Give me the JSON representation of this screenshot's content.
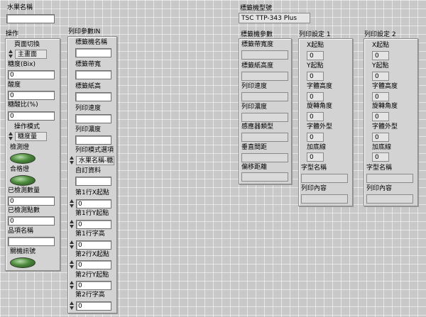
{
  "top": {
    "fruit_name_label": "水果名稱",
    "fruit_name_value": "",
    "printer_model_label": "標籤機型號",
    "printer_model_value": "TSC TTP-343 Plus"
  },
  "operation": {
    "title": "操作",
    "page_switch_label": "頁面切換",
    "page_switch_value": "主畫面",
    "brix_label": "糖度(Bix)",
    "brix_value": "0",
    "acid_label": "酸度",
    "acid_value": "0",
    "ratio_label": "糖酸比(%)",
    "ratio_value": "0",
    "mode_label": "操作模式",
    "mode_value": "糖度量",
    "detect_led_label": "檢測燈",
    "pass_led_label": "合格燈",
    "detected_count_label": "已檢測數量",
    "detected_count_value": "0",
    "detected_points_label": "已檢測點數",
    "detected_points_value": "0",
    "item_name_label": "品項名稱",
    "item_name_value": "",
    "shutdown_label": "關機訊號"
  },
  "print_params": {
    "title": "列印參數IN",
    "label_machine_name_label": "標籤機名稱",
    "label_machine_name_value": "",
    "label_width_label": "標籤帶寬",
    "label_width_value": "",
    "label_height_label": "標籤紙高",
    "label_height_value": "",
    "print_speed_label": "列印速度",
    "print_speed_value": "",
    "print_density_label": "列印濃度",
    "print_density_value": "",
    "print_mode_label": "列印模式選項",
    "print_mode_value": "水果名稱-糖度資料",
    "custom_data_label": "自訂資料",
    "custom_data_value": "",
    "line1_x_label": "第1行X起點",
    "line1_x_value": "0",
    "line1_y_label": "第1行Y起點",
    "line1_y_value": "0",
    "line1_height_label": "第1行字高",
    "line1_height_value": "0",
    "line2_x_label": "第2行X起點",
    "line2_x_value": "0",
    "line2_y_label": "第2行Y起點",
    "line2_y_value": "0",
    "line2_height_label": "第2行字高",
    "line2_height_value": "0"
  },
  "label_params": {
    "title": "標籤機參數",
    "label_width_label": "標籤帶寬度",
    "label_height_label": "標籤紙高度",
    "print_speed_label": "列印速度",
    "print_density_label": "列印濃度",
    "sensor_type_label": "感應器類型",
    "vertical_gap_label": "垂直間距",
    "offset_label": "偏移距離"
  },
  "print_settings_1": {
    "title": "列印設定 1",
    "x_label": "X起點",
    "x_value": "0",
    "y_label": "Y起點",
    "y_value": "0",
    "font_height_label": "字體高度",
    "font_height_value": "0",
    "rotation_label": "旋轉角度",
    "rotation_value": "0",
    "font_style_label": "字體外型",
    "font_style_value": "0",
    "underline_label": "加底線",
    "underline_value": "0",
    "font_name_label": "字型名稱",
    "print_content_label": "列印內容"
  },
  "print_settings_2": {
    "title": "列印設定 2",
    "x_label": "X起點",
    "x_value": "0",
    "y_label": "Y起點",
    "y_value": "0",
    "font_height_label": "字體高度",
    "font_height_value": "0",
    "rotation_label": "旋轉角度",
    "rotation_value": "0",
    "font_style_label": "字體外型",
    "font_style_value": "0",
    "underline_label": "加底線",
    "underline_value": "0",
    "font_name_label": "字型名稱",
    "print_content_label": "列印內容"
  }
}
